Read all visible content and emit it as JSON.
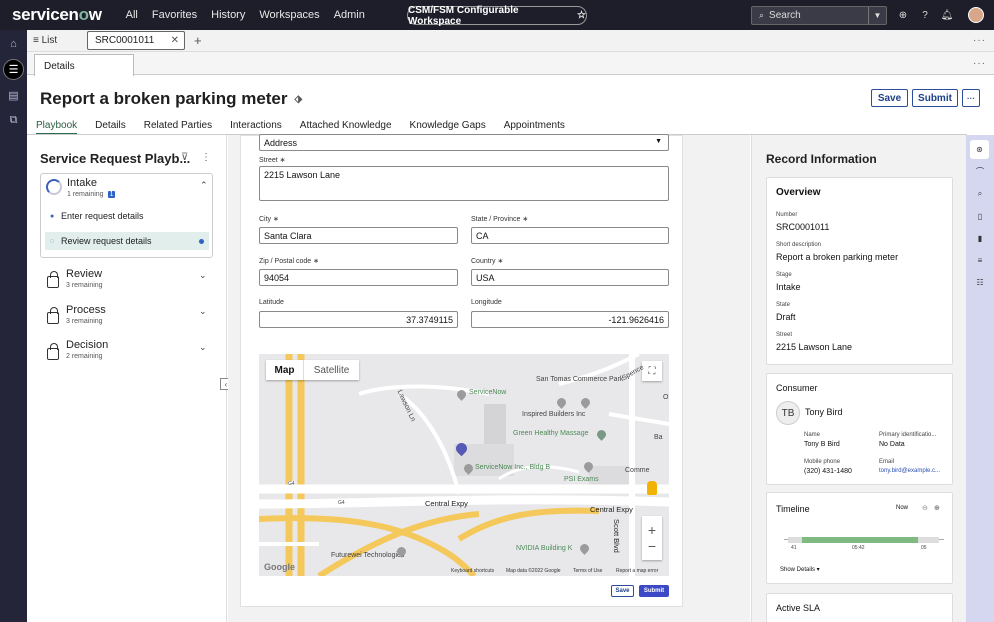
{
  "topnav": {
    "brand_pre": "servicen",
    "brand_o": "o",
    "brand_post": "w",
    "links": [
      "All",
      "Favorites",
      "History",
      "Workspaces",
      "Admin"
    ],
    "workspace": "CSM/FSM Configurable Workspace",
    "search_placeholder": "Search"
  },
  "tabs": {
    "list_label": "≡ List",
    "record_tab": "SRC0001011"
  },
  "detail_tab": "Details",
  "record": {
    "title": "Report a broken parking meter",
    "save_label": "Save",
    "submit_label": "Submit",
    "more_label": "···"
  },
  "record_tabs": [
    "Playbook",
    "Details",
    "Related Parties",
    "Interactions",
    "Attached Knowledge",
    "Knowledge Gaps",
    "Appointments"
  ],
  "playbook": {
    "title": "Service Request Playb...",
    "stages": [
      {
        "name": "Intake",
        "sub": "1 remaining",
        "badge": "1"
      },
      {
        "name": "Review",
        "sub": "3 remaining"
      },
      {
        "name": "Process",
        "sub": "3 remaining"
      },
      {
        "name": "Decision",
        "sub": "2 remaining"
      }
    ],
    "tasks": [
      "Enter request details",
      "Review request details"
    ]
  },
  "form": {
    "address_type": "Address",
    "street_label": "Street ∗",
    "street_value": "2215 Lawson Lane",
    "city_label": "City ∗",
    "city_value": "Santa Clara",
    "state_label": "State / Province ∗",
    "state_value": "CA",
    "zip_label": "Zip / Postal code ∗",
    "zip_value": "94054",
    "country_label": "Country ∗",
    "country_value": "USA",
    "lat_label": "Latitude",
    "lat_value": "37.3749115",
    "lng_label": "Longitude",
    "lng_value": "-121.9626416",
    "save_label": "Save",
    "submit_label": "Submit"
  },
  "map": {
    "map_label": "Map",
    "satellite_label": "Satellite",
    "labels": [
      "ServiceNow",
      "San Tomas Commerce Park",
      "Inspired Builders Inc",
      "Green Healthy Massage",
      "ServiceNow Inc., Bldg B",
      "PSI Exams",
      "Central Expy",
      "Central Expy",
      "Scott Blvd",
      "NVIDIA Building K",
      "Futurewei Technologies",
      "Lawson Ln",
      "Comme",
      "Spence",
      "Ba",
      "Oi",
      "G4",
      "G4"
    ],
    "google": "Google",
    "footer": [
      "Keyboard shortcuts",
      "Map data ©2022 Google",
      "Terms of Use",
      "Report a map error"
    ],
    "zoom_in": "+",
    "zoom_out": "−"
  },
  "record_info": {
    "title": "Record Information",
    "overview_title": "Overview",
    "fields": [
      {
        "key": "Number",
        "val": "SRC0001011"
      },
      {
        "key": "Short description",
        "val": "Report a broken parking meter"
      },
      {
        "key": "Stage",
        "val": "Intake"
      },
      {
        "key": "State",
        "val": "Draft"
      },
      {
        "key": "Street",
        "val": "2215 Lawson Lane"
      }
    ],
    "consumer_title": "Consumer",
    "consumer_initials": "TB",
    "consumer_name": "Tony Bird",
    "name_key": "Name",
    "name_val": "Tony B Bird",
    "primary_key": "Primary identificatio...",
    "primary_val": "No Data",
    "mobile_key": "Mobile phone",
    "mobile_val": "(320) 431-1480",
    "email_key": "Email",
    "email_val": "tony.bird@example.c...",
    "timeline_title": "Timeline",
    "timeline_now": "Now",
    "timeline_ticks": [
      "41",
      "05:42",
      "05"
    ],
    "show_details": "Show Details ▾",
    "sla_title": "Active SLA"
  },
  "colors": {
    "nav_bg": "#1e1e2a",
    "accent_green": "#2e6e50",
    "primary_blue": "#3b49c7",
    "rail_purple": "#d5d6ef"
  }
}
